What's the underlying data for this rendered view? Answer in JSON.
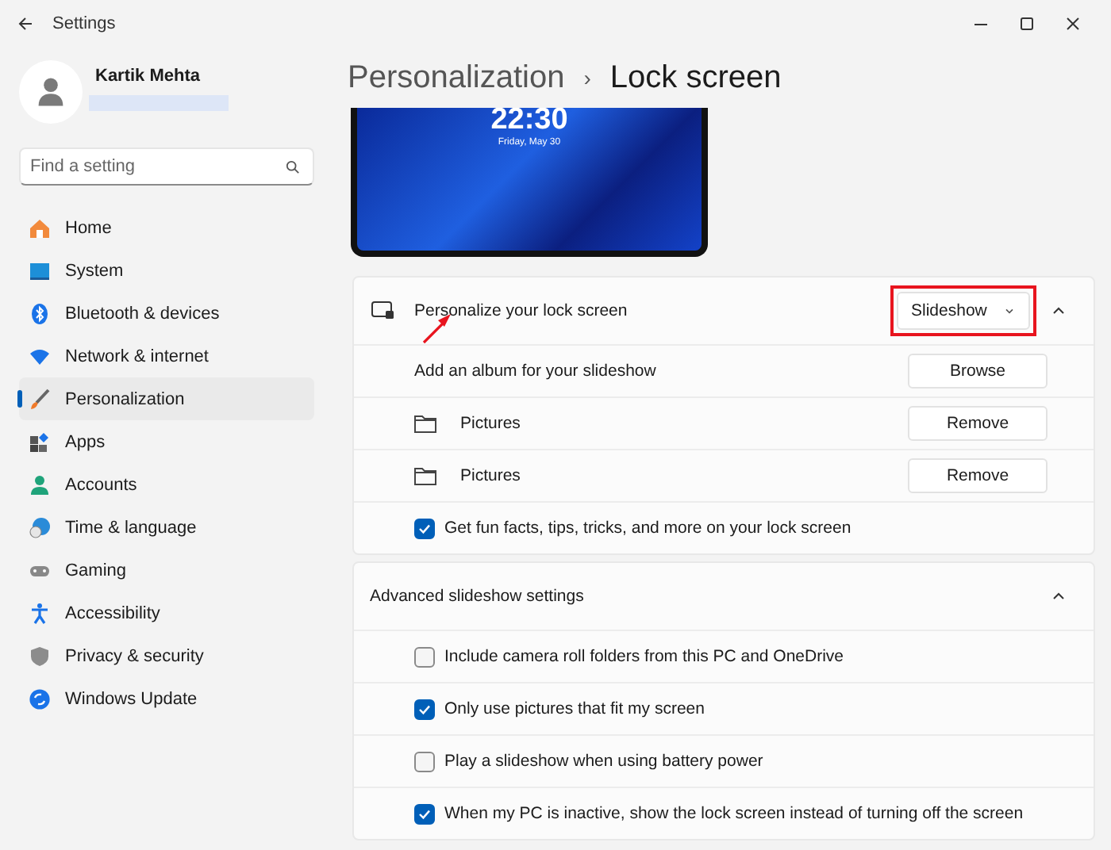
{
  "window": {
    "title": "Settings"
  },
  "user": {
    "name": "Kartik Mehta"
  },
  "search": {
    "placeholder": "Find a setting"
  },
  "nav": [
    {
      "label": "Home",
      "selected": false
    },
    {
      "label": "System",
      "selected": false
    },
    {
      "label": "Bluetooth & devices",
      "selected": false
    },
    {
      "label": "Network & internet",
      "selected": false
    },
    {
      "label": "Personalization",
      "selected": true
    },
    {
      "label": "Apps",
      "selected": false
    },
    {
      "label": "Accounts",
      "selected": false
    },
    {
      "label": "Time & language",
      "selected": false
    },
    {
      "label": "Gaming",
      "selected": false
    },
    {
      "label": "Accessibility",
      "selected": false
    },
    {
      "label": "Privacy & security",
      "selected": false
    },
    {
      "label": "Windows Update",
      "selected": false
    }
  ],
  "breadcrumb": {
    "parent": "Personalization",
    "separator": "›",
    "current": "Lock screen"
  },
  "preview": {
    "time": "22:30",
    "date": "Friday, May 30"
  },
  "lock_screen_card": {
    "label": "Personalize your lock screen",
    "dropdown": "Slideshow",
    "highlighted": true,
    "pointer_arrow": true,
    "expanded": true,
    "rows": [
      {
        "kind": "action",
        "label": "Add an album for your slideshow",
        "button": "Browse"
      },
      {
        "kind": "folder",
        "label": "Pictures",
        "button": "Remove"
      },
      {
        "kind": "folder",
        "label": "Pictures",
        "button": "Remove"
      },
      {
        "kind": "checkbox",
        "label": "Get fun facts, tips, tricks, and more on your lock screen",
        "checked": true
      }
    ]
  },
  "advanced_card": {
    "title": "Advanced slideshow settings",
    "expanded": true,
    "rows": [
      {
        "kind": "checkbox",
        "label": "Include camera roll folders from this PC and OneDrive",
        "checked": false
      },
      {
        "kind": "checkbox",
        "label": "Only use pictures that fit my screen",
        "checked": true
      },
      {
        "kind": "checkbox",
        "label": "Play a slideshow when using battery power",
        "checked": false
      },
      {
        "kind": "checkbox",
        "label": "When my PC is inactive, show the lock screen instead of turning off the screen",
        "checked": true
      }
    ]
  }
}
